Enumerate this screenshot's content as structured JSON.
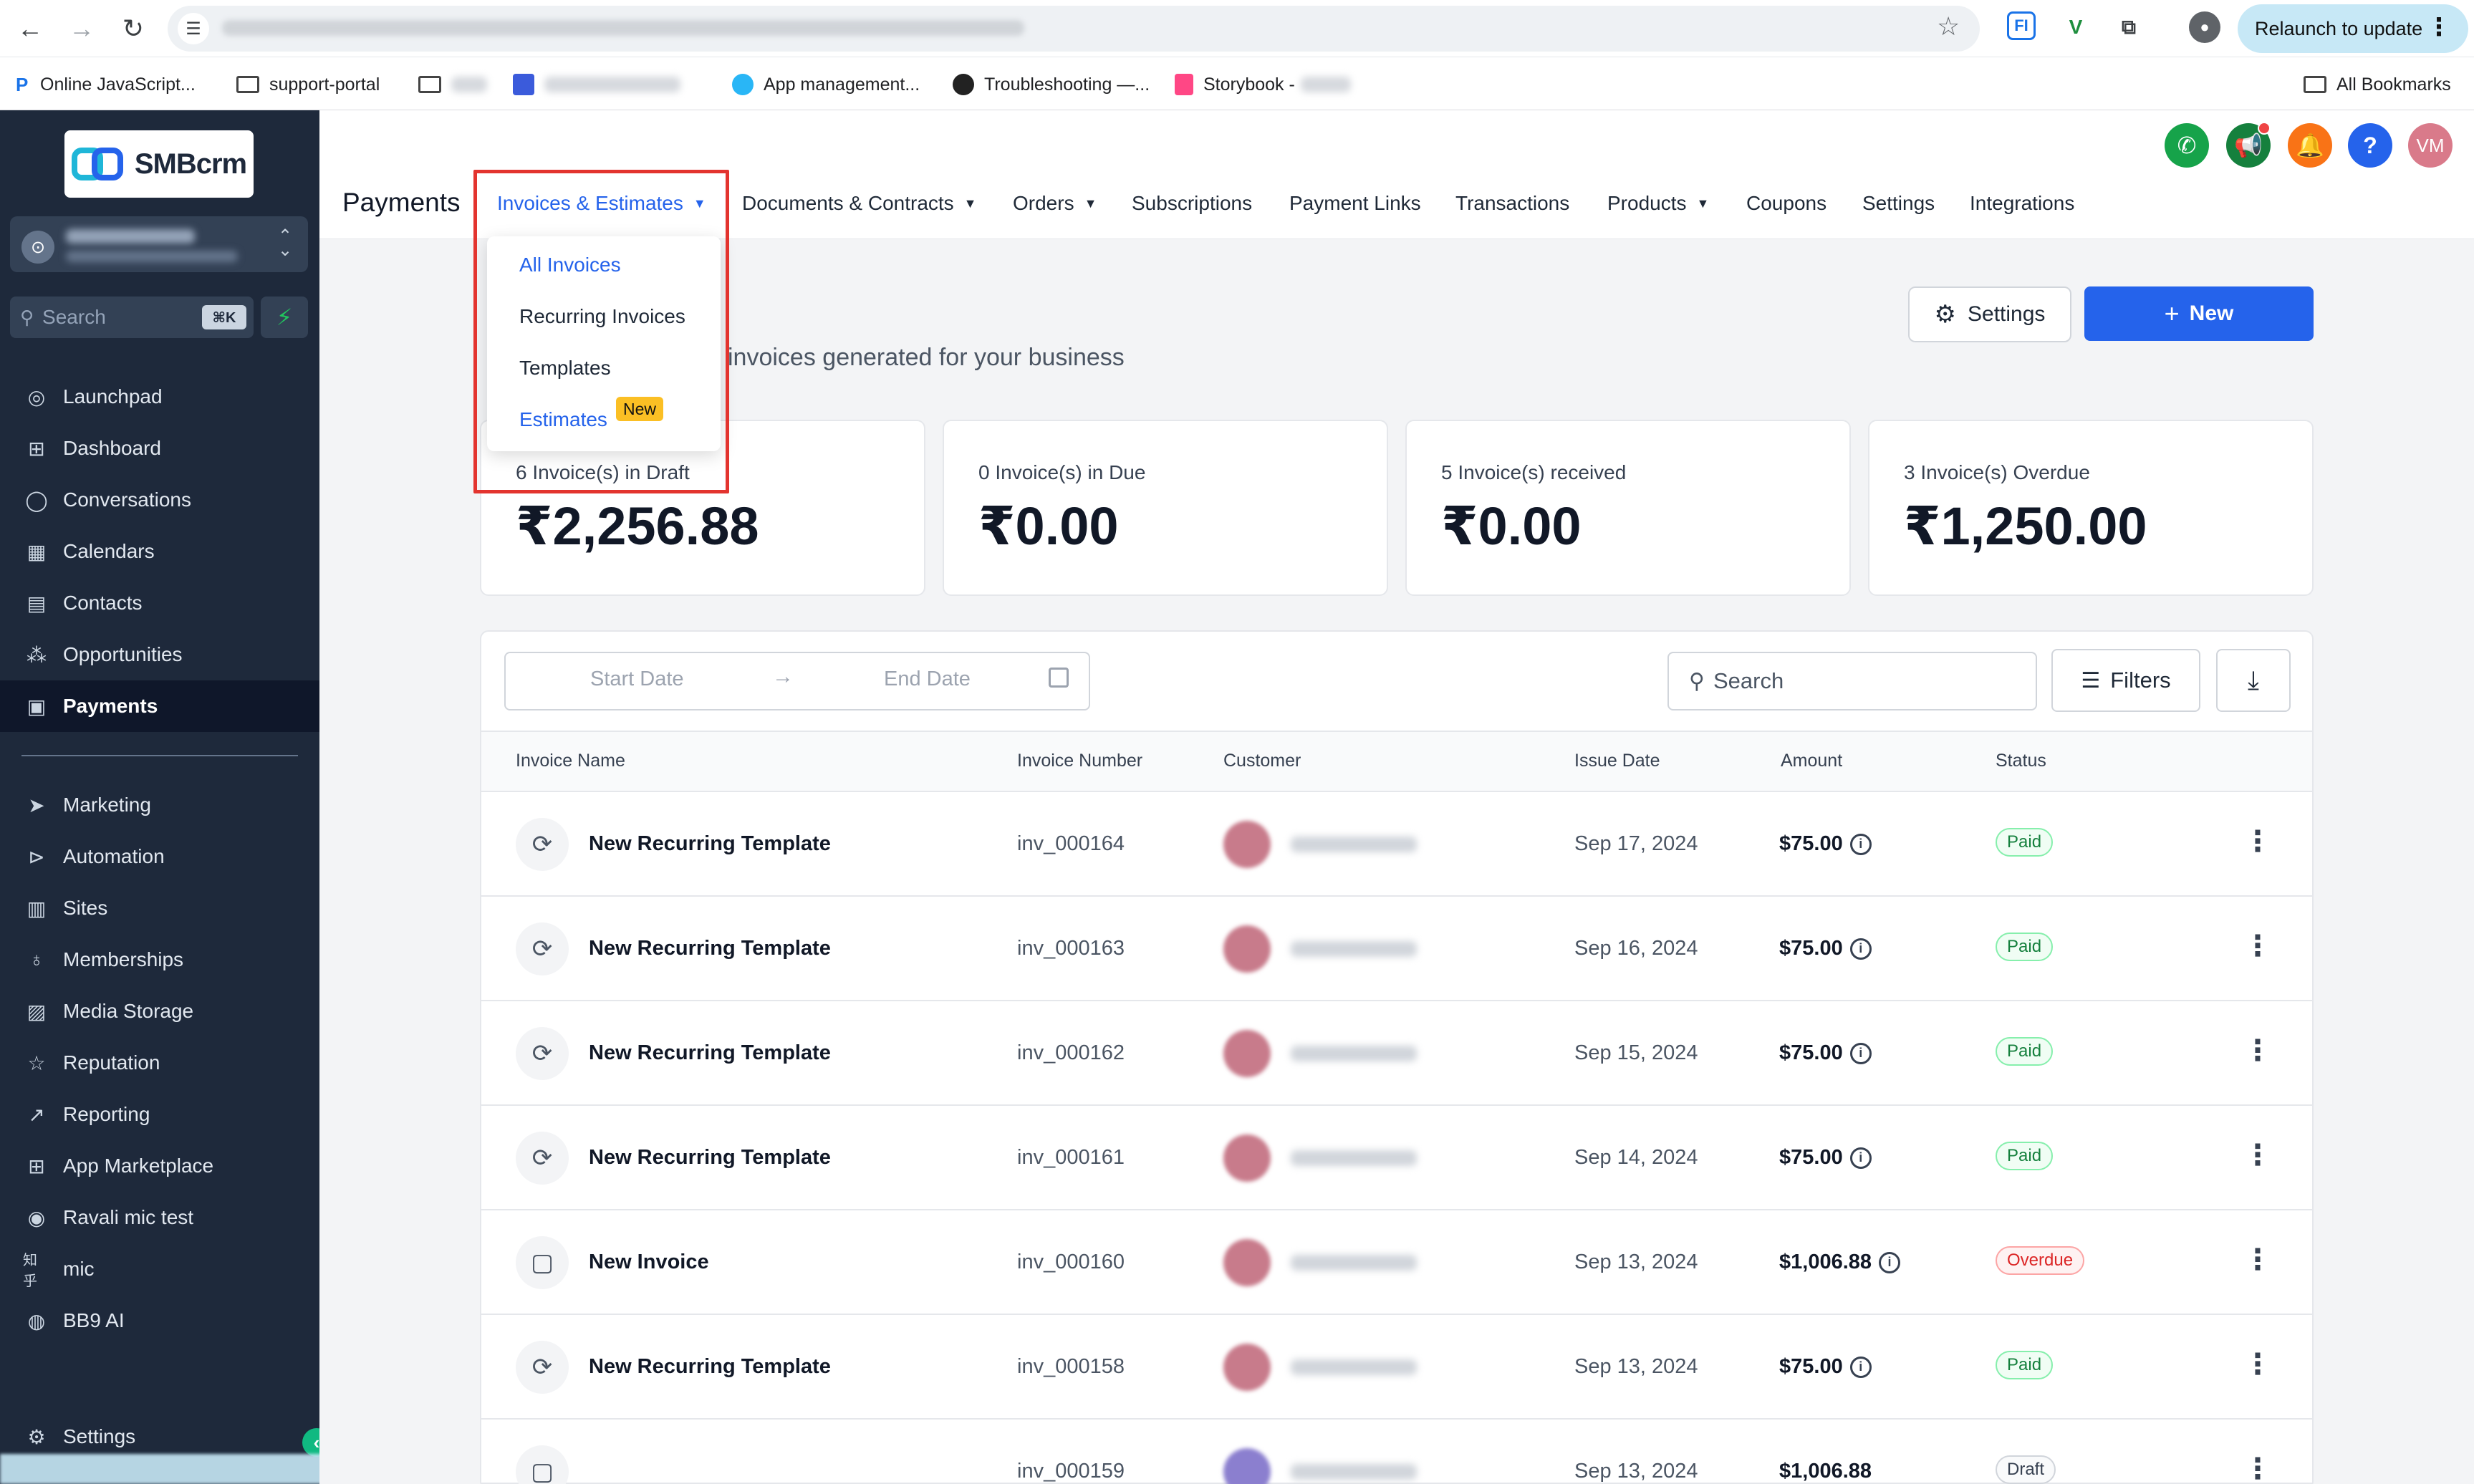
{
  "browser": {
    "relaunch_label": "Relaunch to update",
    "bookmarks": [
      {
        "label": "Online JavaScript..."
      },
      {
        "label": "support-portal"
      },
      {
        "label": "App management..."
      },
      {
        "label": "Troubleshooting —..."
      },
      {
        "label": "Storybook -"
      }
    ],
    "all_bookmarks": "All Bookmarks"
  },
  "sidebar": {
    "logo_text": "SMBcrm",
    "search_placeholder": "Search",
    "search_shortcut": "⌘K",
    "items": [
      {
        "label": "Launchpad",
        "icon": "launchpad-icon"
      },
      {
        "label": "Dashboard",
        "icon": "dashboard-icon"
      },
      {
        "label": "Conversations",
        "icon": "chat-icon"
      },
      {
        "label": "Calendars",
        "icon": "calendar-icon"
      },
      {
        "label": "Contacts",
        "icon": "contacts-icon"
      },
      {
        "label": "Opportunities",
        "icon": "opportunities-icon"
      },
      {
        "label": "Payments",
        "icon": "payments-icon",
        "active": true
      }
    ],
    "items2": [
      {
        "label": "Marketing",
        "icon": "send-icon"
      },
      {
        "label": "Automation",
        "icon": "automation-icon"
      },
      {
        "label": "Sites",
        "icon": "sites-icon"
      },
      {
        "label": "Memberships",
        "icon": "memberships-icon"
      },
      {
        "label": "Media Storage",
        "icon": "media-icon"
      },
      {
        "label": "Reputation",
        "icon": "star-icon"
      },
      {
        "label": "Reporting",
        "icon": "trend-icon"
      },
      {
        "label": "App Marketplace",
        "icon": "grid-icon"
      },
      {
        "label": "Ravali mic test",
        "icon": "globe-icon"
      },
      {
        "label": "mic",
        "icon": "zhihu-icon"
      },
      {
        "label": "BB9 AI",
        "icon": "ai-chat-icon"
      }
    ],
    "settings_label": "Settings"
  },
  "header": {
    "avatar_initials": "VM",
    "title": "Payments",
    "nav": [
      {
        "label": "Invoices & Estimates",
        "has_chevron": true,
        "active": true
      },
      {
        "label": "Documents & Contracts",
        "has_chevron": true
      },
      {
        "label": "Orders",
        "has_chevron": true
      },
      {
        "label": "Subscriptions"
      },
      {
        "label": "Payment Links"
      },
      {
        "label": "Transactions"
      },
      {
        "label": "Products",
        "has_chevron": true
      },
      {
        "label": "Coupons"
      },
      {
        "label": "Settings"
      },
      {
        "label": "Integrations"
      }
    ],
    "dropdown": [
      {
        "label": "All Invoices"
      },
      {
        "label": "Recurring Invoices"
      },
      {
        "label": "Templates"
      },
      {
        "label": "Estimates",
        "badge": "New"
      }
    ]
  },
  "main": {
    "subtitle": "invoices generated for your business",
    "settings_button": "Settings",
    "new_button": "New",
    "stats": [
      {
        "label": "6 Invoice(s) in Draft",
        "value": "₹2,256.88"
      },
      {
        "label": "0 Invoice(s) in Due",
        "value": "₹0.00"
      },
      {
        "label": "5 Invoice(s) received",
        "value": "₹0.00"
      },
      {
        "label": "3 Invoice(s) Overdue",
        "value": "₹1,250.00"
      }
    ],
    "start_date_placeholder": "Start Date",
    "end_date_placeholder": "End Date",
    "search_placeholder": "Search",
    "filters_label": "Filters",
    "columns": [
      "Invoice Name",
      "Invoice Number",
      "Customer",
      "Issue Date",
      "Amount",
      "Status"
    ],
    "rows": [
      {
        "name": "New Recurring Template",
        "number": "inv_000164",
        "date": "Sep 17, 2024",
        "amount": "$75.00",
        "status": "Paid",
        "kind": "recurring"
      },
      {
        "name": "New Recurring Template",
        "number": "inv_000163",
        "date": "Sep 16, 2024",
        "amount": "$75.00",
        "status": "Paid",
        "kind": "recurring"
      },
      {
        "name": "New Recurring Template",
        "number": "inv_000162",
        "date": "Sep 15, 2024",
        "amount": "$75.00",
        "status": "Paid",
        "kind": "recurring"
      },
      {
        "name": "New Recurring Template",
        "number": "inv_000161",
        "date": "Sep 14, 2024",
        "amount": "$75.00",
        "status": "Paid",
        "kind": "recurring"
      },
      {
        "name": "New Invoice",
        "number": "inv_000160",
        "date": "Sep 13, 2024",
        "amount": "$1,006.88",
        "status": "Overdue",
        "kind": "invoice"
      },
      {
        "name": "New Recurring Template",
        "number": "inv_000158",
        "date": "Sep 13, 2024",
        "amount": "$75.00",
        "status": "Paid",
        "kind": "recurring"
      },
      {
        "name": "",
        "number": "inv_000159",
        "date": "Sep 13, 2024",
        "amount": "$1,006.88",
        "status": "Draft",
        "kind": "invoice"
      }
    ]
  },
  "colors": {
    "accent": "#2563eb",
    "sidebar_bg": "#1e293b",
    "highlight": "#e3342f",
    "phone": "#16a34a",
    "megaphone": "#15803d",
    "bell": "#f97316",
    "help": "#2563eb",
    "avatar": "#d97a8a"
  }
}
